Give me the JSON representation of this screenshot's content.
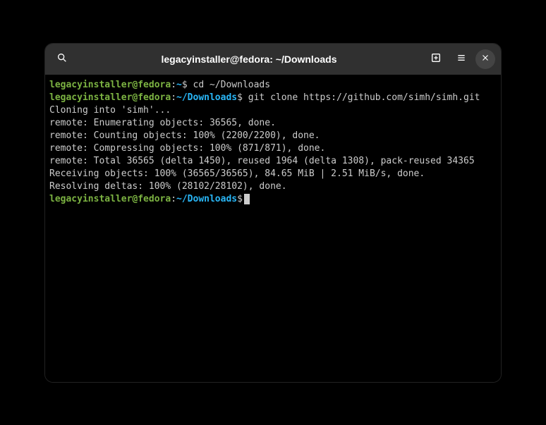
{
  "window": {
    "title": "legacyinstaller@fedora: ~/Downloads"
  },
  "prompts": {
    "userhost": "legacyinstaller@fedora",
    "colon": ":",
    "home": "~",
    "downloads": "~/Downloads",
    "dollar": "$"
  },
  "cmds": {
    "cd": " cd ~/Downloads",
    "clone": " git clone https://github.com/simh/simh.git"
  },
  "output": {
    "l1": "Cloning into 'simh'...",
    "l2": "remote: Enumerating objects: 36565, done.",
    "l3": "remote: Counting objects: 100% (2200/2200), done.",
    "l4": "remote: Compressing objects: 100% (871/871), done.",
    "l5": "remote: Total 36565 (delta 1450), reused 1964 (delta 1308), pack-reused 34365",
    "l6": "Receiving objects: 100% (36565/36565), 84.65 MiB | 2.51 MiB/s, done.",
    "l7": "Resolving deltas: 100% (28102/28102), done."
  }
}
